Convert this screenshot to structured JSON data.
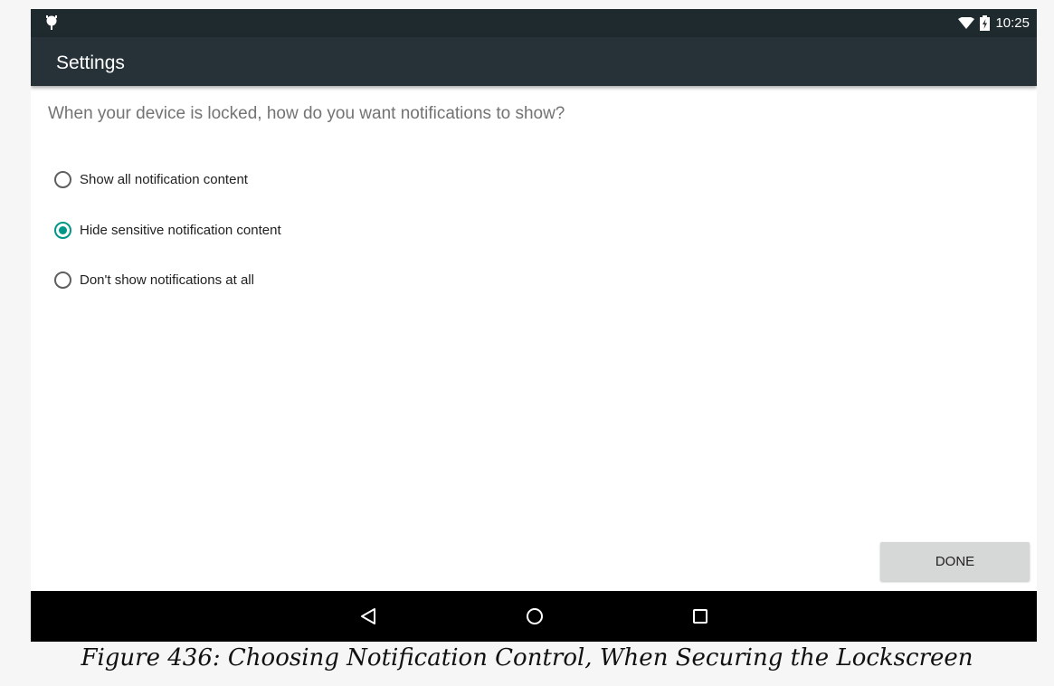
{
  "status_bar": {
    "time": "10:25",
    "icons": [
      "android-debug-icon",
      "wifi-icon",
      "battery-icon"
    ]
  },
  "app_bar": {
    "title": "Settings",
    "color": "#263238"
  },
  "content": {
    "prompt": "When your device is locked, how do you want notifications to show?",
    "options": [
      {
        "label": "Show all notification content",
        "selected": false
      },
      {
        "label": "Hide sensitive notification content",
        "selected": true
      },
      {
        "label": "Don't show notifications at all",
        "selected": false
      }
    ],
    "accent_color": "#009688",
    "done_label": "DONE"
  },
  "nav_bar": {
    "icons": [
      "back-icon",
      "home-icon",
      "recents-icon"
    ]
  },
  "caption": "Figure 436: Choosing Notification Control, When Securing the Lockscreen"
}
